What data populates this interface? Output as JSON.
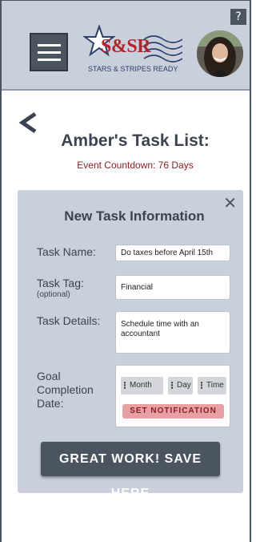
{
  "header": {
    "help_label": "?",
    "logo": {
      "name": "S&SR",
      "tagline": "STARS & STRIPES READY"
    }
  },
  "page": {
    "title": "Amber's Task List:",
    "countdown": "Event Countdown: 76 Days"
  },
  "form": {
    "title": "New Task Information",
    "close_label": "✕",
    "task_name": {
      "label": "Task Name:",
      "value": "Do taxes before April 15th"
    },
    "task_tag": {
      "label": "Task Tag:",
      "hint": "(optional)",
      "value": "Financial"
    },
    "task_details": {
      "label": "Task Details:",
      "value": "Schedule time with an accountant"
    },
    "goal_date": {
      "label_line1": "Goal",
      "label_line2": "Completion",
      "label_line3": "Date:",
      "month": "Month",
      "day": "Day",
      "time": "Time",
      "notify_label": "SET NOTIFICATION"
    },
    "save_label": "GREAT WORK! SAVE HERE"
  },
  "colors": {
    "header_bg": "#c9d0dc",
    "dark_slate": "#4b5560",
    "accent_red": "#8b1e24",
    "notify_bg": "#e7a1a5"
  }
}
